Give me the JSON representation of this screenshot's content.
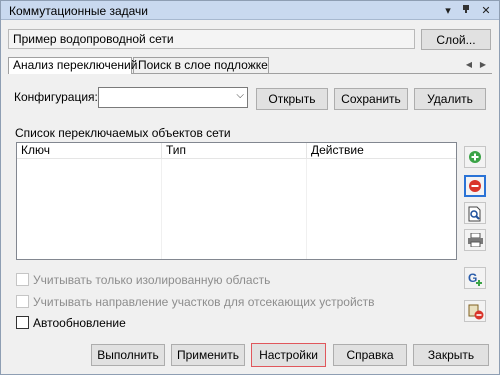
{
  "window": {
    "title": "Коммутационные задачи"
  },
  "map": {
    "name": "Пример водопроводной сети",
    "layer_button": "Слой..."
  },
  "tabs": [
    {
      "label": "Анализ переключений",
      "active": true
    },
    {
      "label": "Поиск в слое подложке",
      "active": false
    }
  ],
  "config": {
    "label": "Конфигурация:",
    "value": "",
    "open_button": "Открыть",
    "save_button": "Сохранить",
    "delete_button": "Удалить"
  },
  "objects": {
    "title": "Список переключаемых объектов сети",
    "columns": [
      "Ключ",
      "Тип",
      "Действие"
    ],
    "rows": []
  },
  "options": {
    "isolated_only": {
      "label": "Учитывать только изолированную область",
      "checked": false,
      "enabled": false
    },
    "segment_direction": {
      "label": "Учитывать направление участков для отсекающих устройств",
      "checked": false,
      "enabled": false
    },
    "auto_refresh": {
      "label": "Автообновление",
      "checked": false,
      "enabled": true
    }
  },
  "side_icons": [
    "add-icon",
    "remove-icon",
    "zoom-to-icon",
    "print-icon",
    "graph-add-icon",
    "layer-remove-icon"
  ],
  "actions": {
    "execute": "Выполнить",
    "apply": "Применить",
    "settings": "Настройки",
    "help": "Справка",
    "close": "Закрыть"
  },
  "colors": {
    "titlebar": "#c9d9ef",
    "focus_blue": "#2a73d6",
    "settings_border": "#e0575c",
    "add_green": "#3aa346",
    "remove_red": "#d9352b"
  }
}
